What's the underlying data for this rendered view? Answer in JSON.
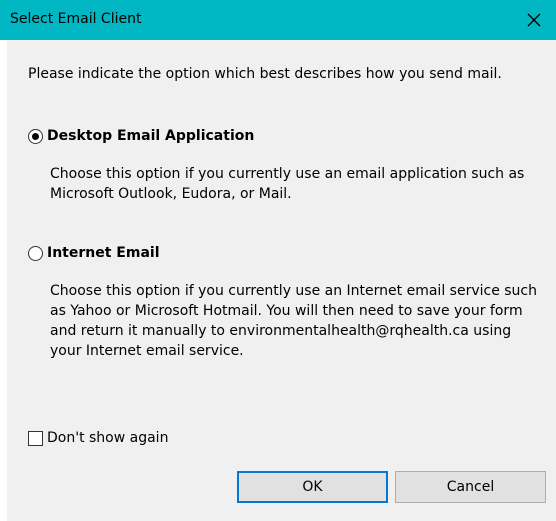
{
  "window": {
    "title": "Select Email Client",
    "close_icon": "close-icon"
  },
  "intro": "Please indicate the option which best describes how you send mail.",
  "options": [
    {
      "label": "Desktop Email Application",
      "checked": true,
      "description": "Choose this option if you currently use an email application such as Microsoft Outlook, Eudora, or Mail."
    },
    {
      "label": "Internet Email",
      "checked": false,
      "description": "Choose this option if you currently use an Internet email service such as Yahoo or Microsoft Hotmail. You will then need to save your form and return it manually to environmentalhealth@rqhealth.ca using your Internet email service."
    }
  ],
  "dont_show_again": {
    "label": "Don't show again",
    "checked": false
  },
  "buttons": {
    "ok": "OK",
    "cancel": "Cancel"
  },
  "colors": {
    "titlebar": "#00b7c3",
    "dialog_bg": "#f0f0f0",
    "default_button_border": "#0078d7"
  }
}
